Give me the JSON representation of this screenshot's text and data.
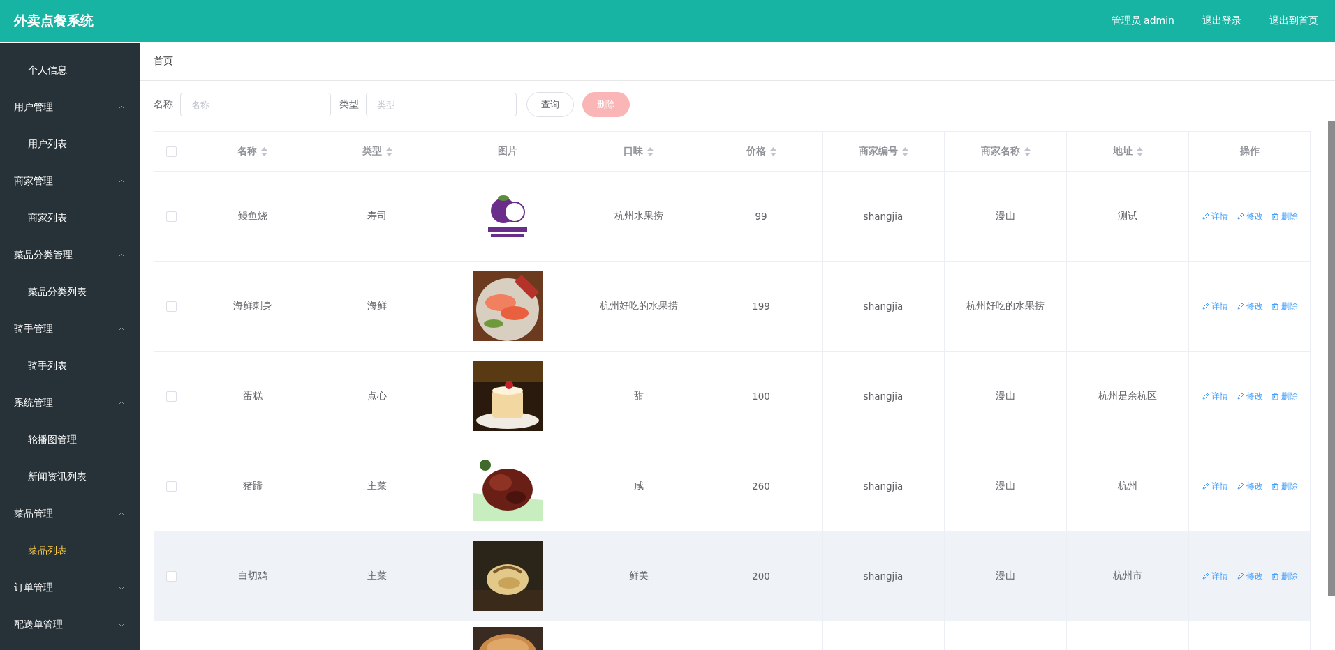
{
  "header": {
    "title": "外卖点餐系统",
    "links": [
      "管理员 admin",
      "退出登录",
      "退出到首页"
    ]
  },
  "sidebar": {
    "items": [
      {
        "label": "个人信息",
        "kind": "leaf",
        "selected": false
      },
      {
        "label": "用户管理",
        "kind": "group",
        "expanded": true,
        "children": [
          {
            "label": "用户列表",
            "selected": false
          }
        ]
      },
      {
        "label": "商家管理",
        "kind": "group",
        "expanded": true,
        "children": [
          {
            "label": "商家列表",
            "selected": false
          }
        ]
      },
      {
        "label": "菜品分类管理",
        "kind": "group",
        "expanded": true,
        "children": [
          {
            "label": "菜品分类列表",
            "selected": false
          }
        ]
      },
      {
        "label": "骑手管理",
        "kind": "group",
        "expanded": true,
        "children": [
          {
            "label": "骑手列表",
            "selected": false
          }
        ]
      },
      {
        "label": "系统管理",
        "kind": "group",
        "expanded": true,
        "children": [
          {
            "label": "轮播图管理",
            "selected": false
          },
          {
            "label": "新闻资讯列表",
            "selected": false
          }
        ]
      },
      {
        "label": "菜品管理",
        "kind": "group",
        "expanded": true,
        "children": [
          {
            "label": "菜品列表",
            "selected": true
          }
        ]
      },
      {
        "label": "订单管理",
        "kind": "group",
        "expanded": false
      },
      {
        "label": "配送单管理",
        "kind": "group",
        "expanded": false
      }
    ]
  },
  "breadcrumb": "首页",
  "filters": [
    {
      "label": "名称",
      "placeholder": "名称"
    },
    {
      "label": "类型",
      "placeholder": "类型"
    }
  ],
  "buttons": [
    {
      "label": "查询",
      "kind": "default"
    },
    {
      "label": "删除",
      "kind": "danger",
      "disabled": true
    }
  ],
  "table": {
    "all_checked": false,
    "columns": [
      {
        "label": "名称",
        "sortable": true
      },
      {
        "label": "类型",
        "sortable": true
      },
      {
        "label": "图片",
        "sortable": false
      },
      {
        "label": "口味",
        "sortable": true
      },
      {
        "label": "价格",
        "sortable": true
      },
      {
        "label": "商家编号",
        "sortable": true
      },
      {
        "label": "商家名称",
        "sortable": true
      },
      {
        "label": "地址",
        "sortable": true
      },
      {
        "label": "操作",
        "sortable": false
      }
    ],
    "rows": [
      {
        "checked": false,
        "hovered": false,
        "name": "鳗鱼烧",
        "type": "寿司",
        "image": {
          "kind": "picture"
        },
        "taste": "杭州水果捞",
        "price": "99",
        "shop_id": "shangjia",
        "shop_name": "漫山",
        "address": "测试",
        "actions": [
          "详情",
          "修改",
          "删除"
        ]
      },
      {
        "checked": false,
        "hovered": false,
        "name": "海鲜刺身",
        "type": "海鲜",
        "image": {
          "kind": "picture"
        },
        "taste": "杭州好吃的水果捞",
        "price": "199",
        "shop_id": "shangjia",
        "shop_name": "杭州好吃的水果捞",
        "actions": [
          "详情",
          "修改",
          "删除"
        ]
      },
      {
        "checked": false,
        "hovered": false,
        "name": "蛋糕",
        "type": "点心",
        "image": {
          "kind": "picture"
        },
        "taste": "甜",
        "price": "100",
        "shop_id": "shangjia",
        "shop_name": "漫山",
        "address": "杭州是余杭区",
        "actions": [
          "详情",
          "修改",
          "删除"
        ]
      },
      {
        "checked": false,
        "hovered": false,
        "name": "猪蹄",
        "type": "主菜",
        "image": {
          "kind": "picture"
        },
        "taste": "咸",
        "price": "260",
        "shop_id": "shangjia",
        "shop_name": "漫山",
        "address": "杭州",
        "actions": [
          "详情",
          "修改",
          "删除"
        ]
      },
      {
        "checked": false,
        "hovered": true,
        "name": "白切鸡",
        "type": "主菜",
        "image": {
          "kind": "picture"
        },
        "taste": "鲜美",
        "price": "200",
        "shop_id": "shangjia",
        "shop_name": "漫山",
        "address": "杭州市",
        "actions": [
          "详情",
          "修改",
          "删除"
        ]
      },
      {
        "image": {
          "kind": "picture"
        }
      }
    ]
  }
}
